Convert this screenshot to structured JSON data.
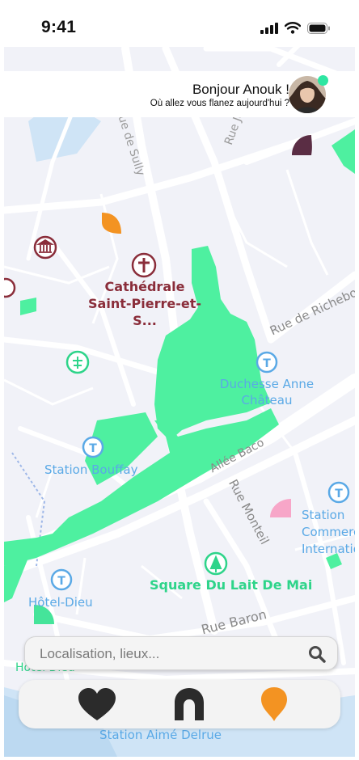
{
  "status_bar": {
    "time": "9:41"
  },
  "greeting": {
    "title": "Bonjour Anouk !",
    "subtitle": "Où allez vous flanez aujourd'hui ?"
  },
  "map": {
    "places": {
      "cathedral": "Cathédrale Saint-Pierre-et-S...",
      "duchesse_anne": "Duchesse Anne Château",
      "station_bouffay": "Station Bouffay",
      "hotel_dieu": "Hôtel-Dieu",
      "square": "Square Du Lait De Mai",
      "station_international": "Station Commerce International",
      "station_aime": "Station Aimé Delrue",
      "hotel_dieu_bottom": "Hôtel Dieu"
    },
    "streets": {
      "rue_sully": "Rue de Sully",
      "rue_joffre": "Rue Joffre",
      "rue_richebourg": "Rue de Richebourg",
      "allee_baco": "Allée Baco",
      "rue_monteil": "Rue Monteil",
      "rue_baron": "Rue Baron"
    },
    "pins": [
      "plum-pin",
      "orange-pin",
      "pink-pin",
      "green-pin"
    ],
    "colors": {
      "park": "#4ef0a0",
      "plum": "#5a2d44",
      "orange": "#f39322",
      "pink": "#f7a6c8",
      "green": "#45e49a",
      "transit": "#5aa9e6",
      "poi": "#8a2d3a"
    }
  },
  "search": {
    "placeholder": "Localisation, lieux..."
  },
  "nav": {
    "favorites": "heart-icon",
    "places": "arch-icon",
    "location": "location-pin-icon"
  }
}
